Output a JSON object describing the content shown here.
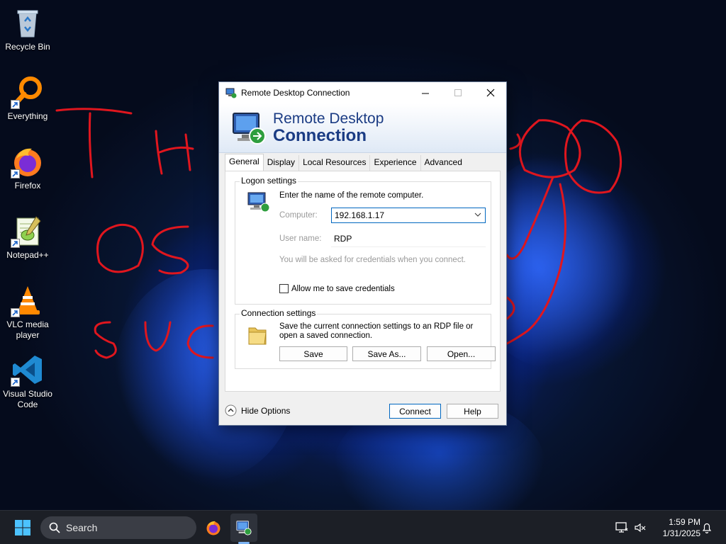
{
  "desktop_icons": [
    {
      "id": "recycle-bin",
      "label": "Recycle Bin"
    },
    {
      "id": "everything",
      "label": "Everything"
    },
    {
      "id": "firefox",
      "label": "Firefox"
    },
    {
      "id": "notepadpp",
      "label": "Notepad++"
    },
    {
      "id": "vlc",
      "label": "VLC media player"
    },
    {
      "id": "vscode",
      "label": "Visual Studio Code"
    }
  ],
  "dialog": {
    "title": "Remote Desktop Connection",
    "banner_line1": "Remote Desktop",
    "banner_line2": "Connection",
    "tabs": [
      "General",
      "Display",
      "Local Resources",
      "Experience",
      "Advanced"
    ],
    "active_tab": "General",
    "logon": {
      "group_title": "Logon settings",
      "instruction": "Enter the name of the remote computer.",
      "computer_label": "Computer:",
      "computer_value": "192.168.1.17",
      "username_label": "User name:",
      "username_value": "RDP",
      "note": "You will be asked for credentials when you connect.",
      "save_credentials_label": "Allow me to save credentials"
    },
    "connection": {
      "group_title": "Connection settings",
      "text": "Save the current connection settings to an RDP file or open a saved connection.",
      "save_label": "Save",
      "save_as_label": "Save As...",
      "open_label": "Open..."
    },
    "hide_options_label": "Hide Options",
    "connect_label": "Connect",
    "help_label": "Help"
  },
  "taskbar": {
    "search_label": "Search",
    "time": "1:59 PM",
    "date": "1/31/2025"
  },
  "colors": {
    "accent": "#0067c0",
    "banner_text": "#1b3c84",
    "scribble": "#e0161e"
  }
}
